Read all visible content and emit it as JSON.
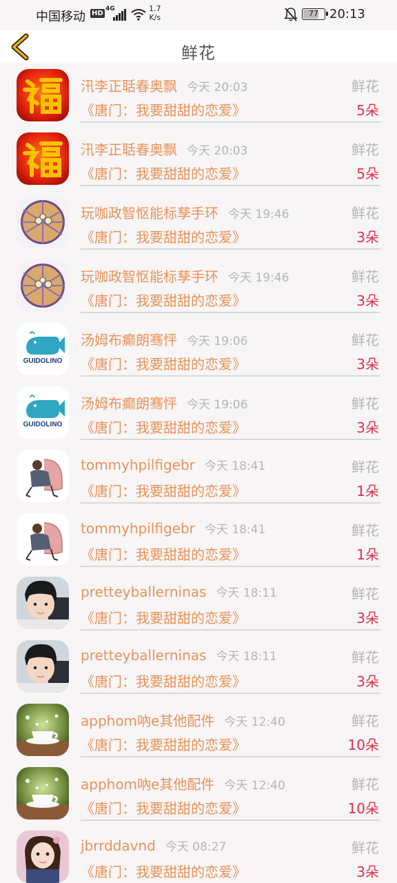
{
  "status_bar": {
    "carrier": "中国移动",
    "hd": "HD",
    "network": "4G",
    "speed_value": "1.7",
    "speed_unit": "K/s",
    "battery": "77",
    "battery_level": 0.77,
    "time": "20:13"
  },
  "header": {
    "title": "鲜花",
    "back_icon": "chevron-left-icon",
    "accent": "#f0b400"
  },
  "colors": {
    "name": "#e8935a",
    "time": "#b5b5b5",
    "count": "#e0304a",
    "divider": "#d8d8d8"
  },
  "items": [
    {
      "avatar": "fu-character",
      "name": "汛李正聒春奥飘",
      "time": "今天 20:03",
      "gift": "鲜花",
      "show": "《唐门：我要甜甜的恋爱》",
      "count": "5朵"
    },
    {
      "avatar": "fu-character",
      "name": "汛李正聒春奥飘",
      "time": "今天 20:03",
      "gift": "鲜花",
      "show": "《唐门：我要甜甜的恋爱》",
      "count": "5朵"
    },
    {
      "avatar": "round-dish",
      "name": "玩咖政智怄能标孳手环",
      "time": "今天 19:46",
      "gift": "鲜花",
      "show": "《唐门：我要甜甜的恋爱》",
      "count": "3朵"
    },
    {
      "avatar": "round-dish",
      "name": "玩咖政智怄能标孳手环",
      "time": "今天 19:46",
      "gift": "鲜花",
      "show": "《唐门：我要甜甜的恋爱》",
      "count": "3朵"
    },
    {
      "avatar": "guidolino-logo",
      "avatar_text": "GUIDOLINO",
      "name": "汤姆布癫朗骞怦",
      "time": "今天 19:06",
      "gift": "鲜花",
      "show": "《唐门：我要甜甜的恋爱》",
      "count": "3朵"
    },
    {
      "avatar": "guidolino-logo",
      "avatar_text": "GUIDOLINO",
      "name": "汤姆布癫朗骞怦",
      "time": "今天 19:06",
      "gift": "鲜花",
      "show": "《唐门：我要甜甜的恋爱》",
      "count": "3朵"
    },
    {
      "avatar": "chair-illustration",
      "name": "tommyhpilfigebr",
      "time": "今天 18:41",
      "gift": "鲜花",
      "show": "《唐门：我要甜甜的恋爱》",
      "count": "1朵"
    },
    {
      "avatar": "chair-illustration",
      "name": "tommyhpilfigebr",
      "time": "今天 18:41",
      "gift": "鲜花",
      "show": "《唐门：我要甜甜的恋爱》",
      "count": "1朵"
    },
    {
      "avatar": "boy-photo",
      "name": "pretteyballerninas",
      "time": "今天 18:11",
      "gift": "鲜花",
      "show": "《唐门：我要甜甜的恋爱》",
      "count": "3朵"
    },
    {
      "avatar": "boy-photo",
      "name": "pretteyballerninas",
      "time": "今天 18:11",
      "gift": "鲜花",
      "show": "《唐门：我要甜甜的恋爱》",
      "count": "3朵"
    },
    {
      "avatar": "teacup-photo",
      "name": "apphom吶e其他配件",
      "time": "今天 12:40",
      "gift": "鲜花",
      "show": "《唐门：我要甜甜的恋爱》",
      "count": "10朵"
    },
    {
      "avatar": "teacup-photo",
      "name": "apphom吶e其他配件",
      "time": "今天 12:40",
      "gift": "鲜花",
      "show": "《唐门：我要甜甜的恋爱》",
      "count": "10朵"
    },
    {
      "avatar": "girl-photo",
      "name": "jbrrddavnd",
      "time": "今天 08:27",
      "gift": "鲜花",
      "show": "《唐门：我要甜甜的恋爱》",
      "count": "3朵"
    }
  ]
}
